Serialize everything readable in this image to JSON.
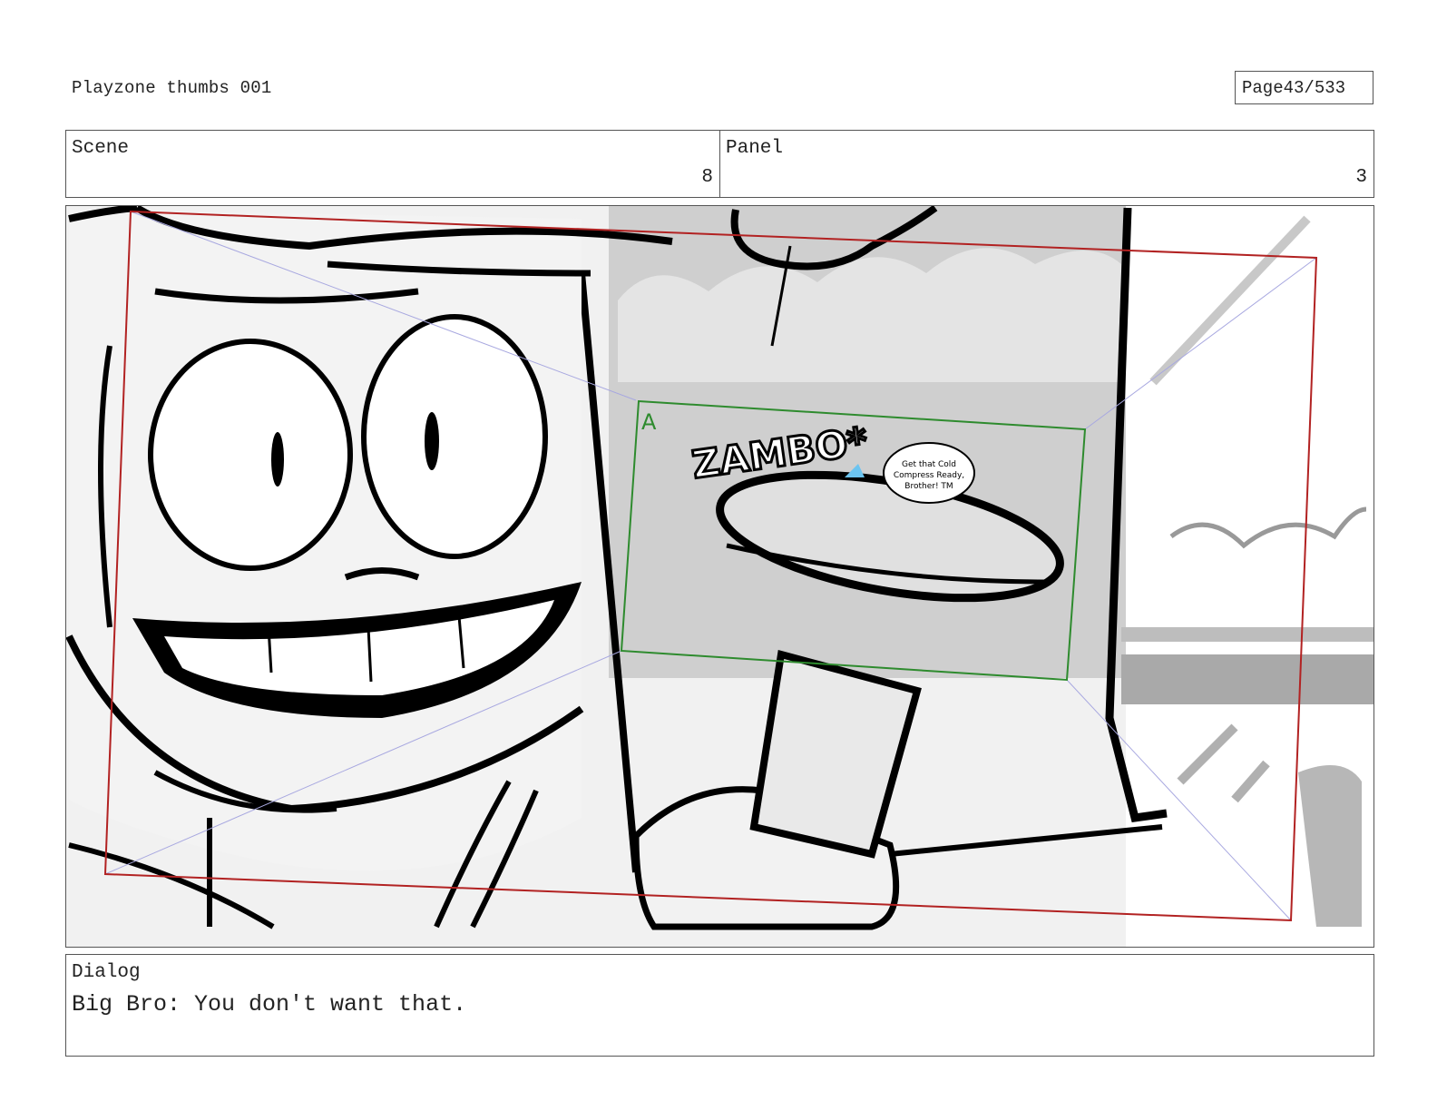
{
  "document": {
    "title": "Playzone thumbs 001",
    "page_label": "Page",
    "page_number": "43/533"
  },
  "scene": {
    "label": "Scene",
    "value": "8"
  },
  "panel": {
    "label": "Panel",
    "value": "3"
  },
  "artwork": {
    "sfx_text": "ZAMBO*",
    "speech_bubble_lines": [
      "Get that Cold",
      "Compress Ready,",
      "Brother! TM"
    ],
    "layer_marker": "A"
  },
  "dialog": {
    "label": "Dialog",
    "text": "Big Bro: You don't want that."
  },
  "colors": {
    "camera_frame": "#b22222",
    "layer_box": "#2e8b2e",
    "guide_lines": "#a8a8e0",
    "bubble_fill": "#ffffff",
    "accent_blue": "#6cc4f0"
  }
}
